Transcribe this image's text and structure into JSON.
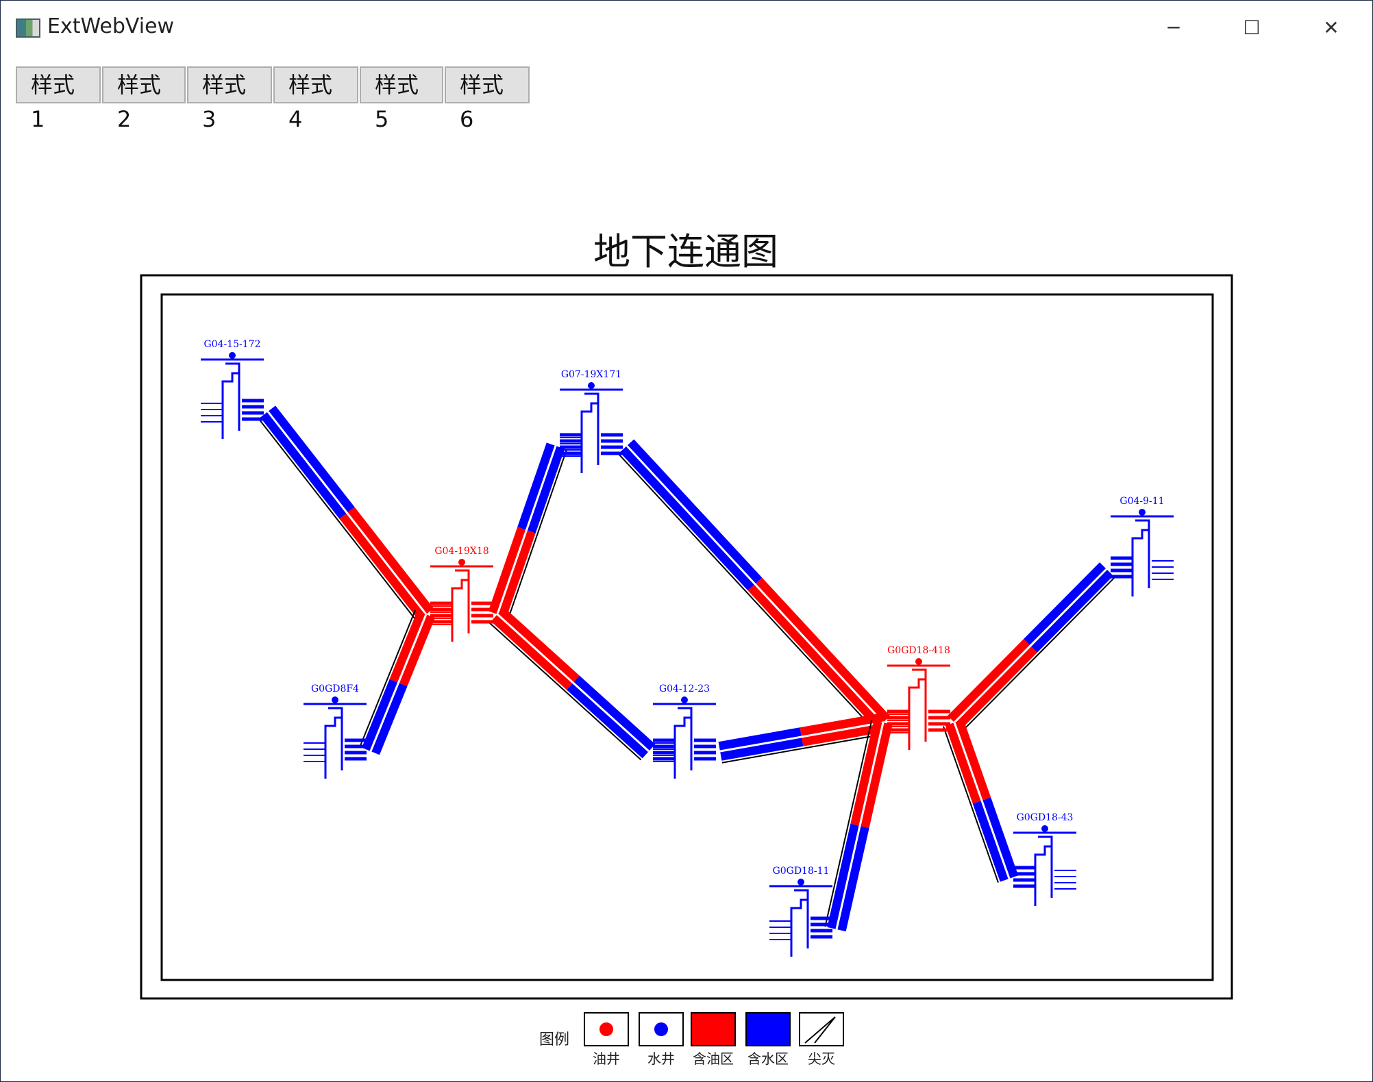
{
  "window": {
    "title": "ExtWebView",
    "minimize": "─",
    "maximize": "☐",
    "close": "✕"
  },
  "toolbar": {
    "buttons": [
      "样式1",
      "样式2",
      "样式3",
      "样式4",
      "样式5",
      "样式6"
    ]
  },
  "chart_data": {
    "type": "diagram",
    "title": "地下连通图",
    "colors": {
      "oil": "#ff0000",
      "water": "#0000ff"
    },
    "wells": [
      {
        "id": "G04-15-172",
        "kind": "water"
      },
      {
        "id": "G07-19X171",
        "kind": "water"
      },
      {
        "id": "G04-19X18",
        "kind": "oil"
      },
      {
        "id": "G0GD8F4",
        "kind": "water"
      },
      {
        "id": "G04-12-23",
        "kind": "water"
      },
      {
        "id": "G0GD18-418",
        "kind": "oil"
      },
      {
        "id": "G04-9-11",
        "kind": "water"
      },
      {
        "id": "G0GD18-43",
        "kind": "water"
      },
      {
        "id": "G0GD18-11",
        "kind": "water"
      }
    ],
    "connections": [
      {
        "from": "G04-15-172",
        "to": "G04-19X18",
        "zones": [
          "water",
          "oil"
        ]
      },
      {
        "from": "G04-19X18",
        "to": "G07-19X171",
        "zones": [
          "oil",
          "water"
        ]
      },
      {
        "from": "G04-19X18",
        "to": "G0GD8F4",
        "zones": [
          "oil",
          "water"
        ]
      },
      {
        "from": "G04-19X18",
        "to": "G04-12-23",
        "zones": [
          "oil",
          "water"
        ]
      },
      {
        "from": "G07-19X171",
        "to": "G0GD18-418",
        "zones": [
          "water",
          "oil"
        ]
      },
      {
        "from": "G04-12-23",
        "to": "G0GD18-418",
        "zones": [
          "water",
          "oil"
        ]
      },
      {
        "from": "G0GD18-418",
        "to": "G04-9-11",
        "zones": [
          "oil",
          "water"
        ]
      },
      {
        "from": "G0GD18-418",
        "to": "G0GD18-43",
        "zones": [
          "oil",
          "water"
        ]
      },
      {
        "from": "G0GD18-418",
        "to": "G0GD18-11",
        "zones": [
          "oil",
          "water"
        ]
      }
    ],
    "legend": {
      "title": "图例",
      "items": [
        {
          "label": "油井",
          "type": "oil-well"
        },
        {
          "label": "水井",
          "type": "water-well"
        },
        {
          "label": "含油区",
          "type": "oil-zone"
        },
        {
          "label": "含水区",
          "type": "water-zone"
        },
        {
          "label": "尖灭",
          "type": "pinch-out"
        }
      ]
    }
  }
}
